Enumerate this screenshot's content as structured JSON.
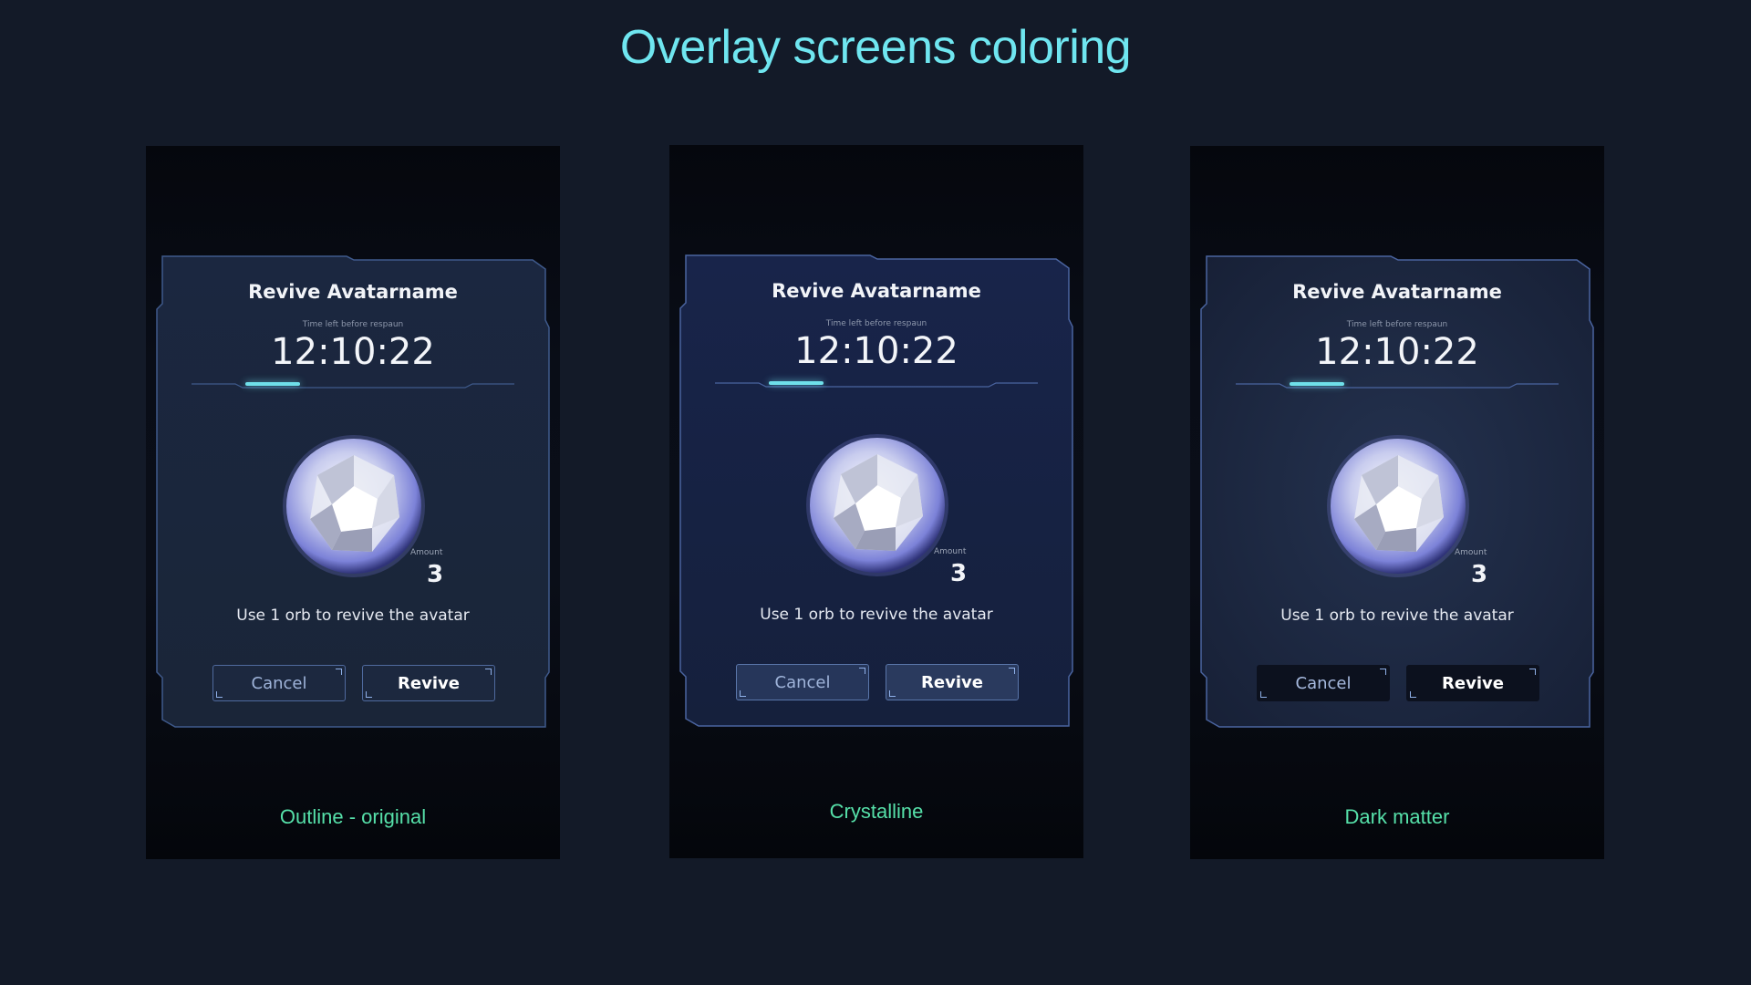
{
  "page": {
    "title": "Overlay screens coloring",
    "title_color": "#6fe6f0"
  },
  "dialog": {
    "title": "Revive Avatarname",
    "timer_label": "Time left before respaun",
    "timer_value": "12:10:22",
    "amount_label": "Amount",
    "amount_value": "3",
    "description": "Use 1 orb to revive the avatar",
    "cancel_label": "Cancel",
    "revive_label": "Revive"
  },
  "variants": [
    {
      "label": "Outline - original",
      "card_fill": "#1a2538",
      "card_stroke": "#3f5a8c"
    },
    {
      "label": "Crystalline",
      "card_fill": "#15203c",
      "card_stroke": "#4a64a0"
    },
    {
      "label": "Dark matter",
      "card_fill": "#1b2740",
      "card_stroke": "#4a64a0"
    }
  ],
  "accent_color": "#6fe0ea",
  "label_color": "#56e0a9"
}
